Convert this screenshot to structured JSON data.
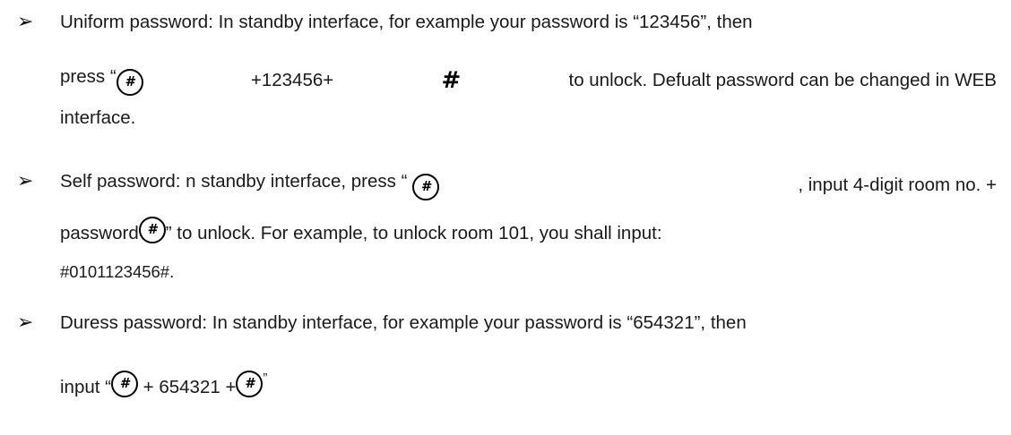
{
  "bullet_symbol": "➢",
  "hash_glyph": "#",
  "items": [
    {
      "lines": [
        [
          "Uniform password: In standby interface, for example your password is “123456”, then"
        ],
        [
          "press “",
          "{icon}",
          " +123456+ ",
          "{hash}",
          " to unlock. Defualt password can be changed in WEB"
        ],
        [
          "interface."
        ]
      ],
      "line1": "Uniform password: In standby interface, for example your password is “123456”, then",
      "line2a": "press “",
      "line2b": " +123456+ ",
      "line2c": " to unlock. Defualt password can be changed in WEB",
      "line3": "interface."
    },
    {
      "line1a": "Self password: n standby interface, press “ ",
      "line1b": ", input 4-digit room no. +",
      "line2a": "password",
      "line2b": "”",
      "line2c": " to unlock. For example, to unlock room 101, you shall input:",
      "line3": "#0101123456#."
    },
    {
      "line1": "Duress password: In standby interface, for example your password is “654321”, then",
      "line2a": "input “",
      "line2b": " + 654321 +",
      "line2c": "”"
    }
  ]
}
